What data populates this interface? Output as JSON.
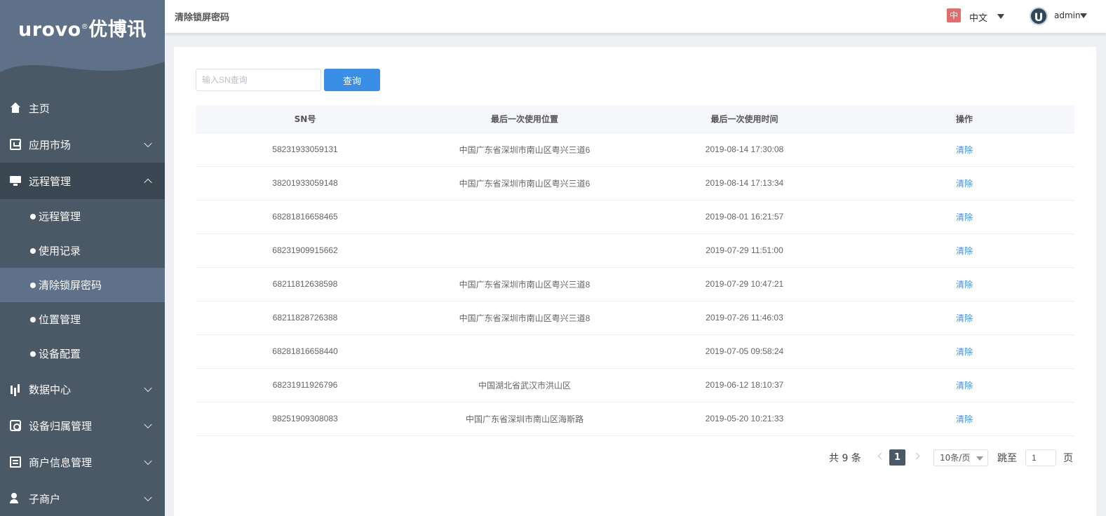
{
  "brand": {
    "logo_text": "urovo",
    "logo_mark": "®",
    "logo_cn": "优博讯"
  },
  "header": {
    "page_title": "清除锁屏密码",
    "lang_badge": "中",
    "lang_label": "中文",
    "avatar_letter": "U",
    "user_name": "admin"
  },
  "sidebar": {
    "items": [
      {
        "label": "主页",
        "icon": "home-icon"
      },
      {
        "label": "应用市场",
        "icon": "store-icon"
      },
      {
        "label": "远程管理",
        "icon": "remote-icon"
      },
      {
        "label": "数据中心",
        "icon": "chart-icon"
      },
      {
        "label": "设备归属管理",
        "icon": "device-icon"
      },
      {
        "label": "商户信息管理",
        "icon": "merchant-card-icon"
      },
      {
        "label": "子商户",
        "icon": "sub-merchant-icon"
      }
    ],
    "sub_items": [
      {
        "label": "远程管理"
      },
      {
        "label": "使用记录"
      },
      {
        "label": "清除锁屏密码"
      },
      {
        "label": "位置管理"
      },
      {
        "label": "设备配置"
      }
    ]
  },
  "search": {
    "placeholder": "输入SN查询",
    "button_label": "查询"
  },
  "table": {
    "headers": [
      "SN号",
      "最后一次使用位置",
      "最后一次使用时间",
      "操作"
    ],
    "rows": [
      {
        "sn": "58231933059131",
        "location": "中国广东省深圳市南山区粤兴三道6",
        "time": "2019-08-14 17:30:08",
        "action": "清除"
      },
      {
        "sn": "38201933059148",
        "location": "中国广东省深圳市南山区粤兴三道6",
        "time": "2019-08-14 17:13:34",
        "action": "清除"
      },
      {
        "sn": "68281816658465",
        "location": "",
        "time": "2019-08-01 16:21:57",
        "action": "清除"
      },
      {
        "sn": "68231909915662",
        "location": "",
        "time": "2019-07-29 11:51:00",
        "action": "清除"
      },
      {
        "sn": "68211812638598",
        "location": "中国广东省深圳市南山区粤兴三道8",
        "time": "2019-07-29 10:47:21",
        "action": "清除"
      },
      {
        "sn": "68211828726388",
        "location": "中国广东省深圳市南山区粤兴三道8",
        "time": "2019-07-26 11:46:03",
        "action": "清除"
      },
      {
        "sn": "68281816658440",
        "location": "",
        "time": "2019-07-05 09:58:24",
        "action": "清除"
      },
      {
        "sn": "68231911926796",
        "location": "中国湖北省武汉市洪山区",
        "time": "2019-06-12 18:10:37",
        "action": "清除"
      },
      {
        "sn": "98251909308083",
        "location": "中国广东省深圳市南山区海斯路",
        "time": "2019-05-20 10:21:33",
        "action": "清除"
      }
    ]
  },
  "pagination": {
    "total_text": "共 9 条",
    "current_page": "1",
    "page_size": "10条/页",
    "goto_label": "跳至",
    "goto_value": "1",
    "page_unit": "页"
  }
}
